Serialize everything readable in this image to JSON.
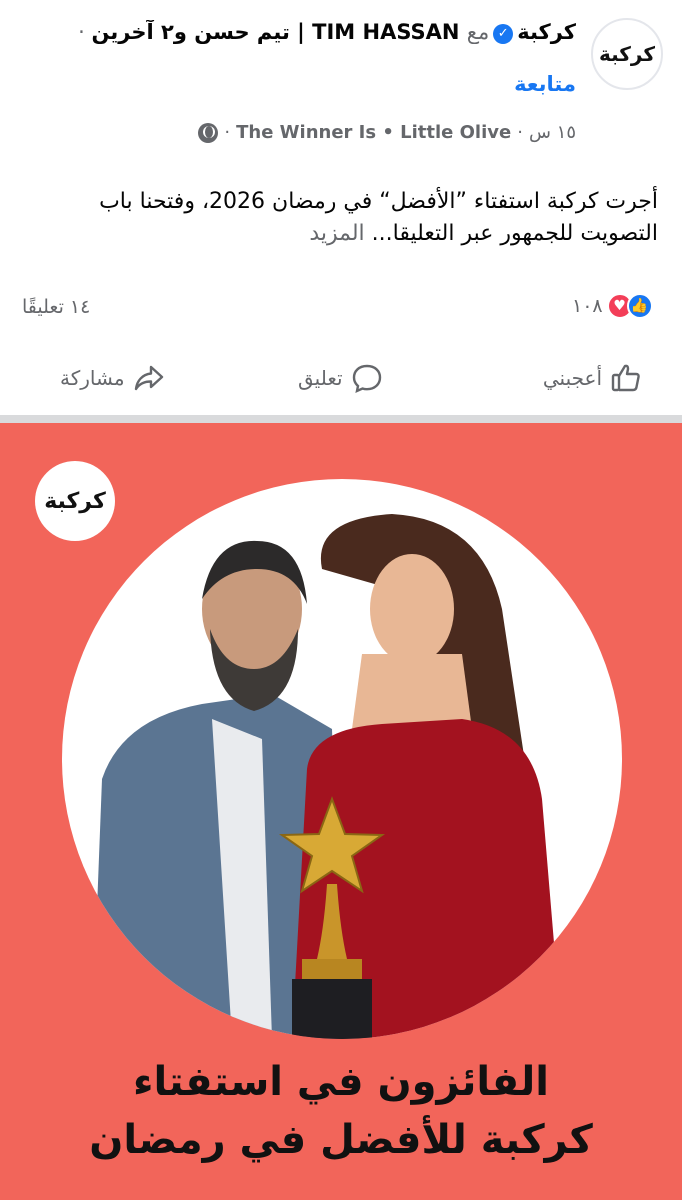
{
  "post": {
    "page_name": "كركبة",
    "with_word": "مع",
    "tagged": "TIM HASSAN | تيم حسن و٢ آخرين",
    "follow_label": "متابعة",
    "time": "١٥ س",
    "tags": "The Winner Is • Little Olive",
    "text": "أجرت كركبة استفتاء ”الأفضل“ في رمضان 2026، وفتحنا باب التصويت للجمهور عبر التعليقا...",
    "more_label": "المزيد",
    "reaction_count": "١٠٨",
    "comments_label": "١٤ تعليقًا"
  },
  "actions": {
    "like": "أعجبني",
    "comment": "تعليق",
    "share": "مشاركة"
  },
  "poster": {
    "logo_text": "كركبة",
    "title_line1": "الفائزون في استفتاء",
    "title_line2": "كركبة للأفضل في رمضان"
  },
  "colors": {
    "accent": "#1877f2",
    "poster_bg": "#f2655a",
    "heart": "#f33e58"
  }
}
